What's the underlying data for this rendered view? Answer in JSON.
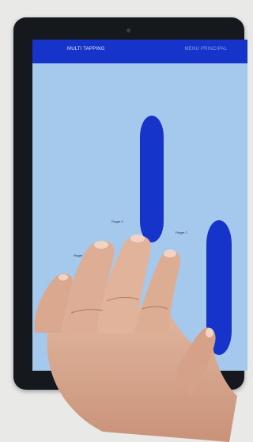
{
  "app": {
    "title": "MULTI TAPPING",
    "action_label": "MENU PRINCIPAL"
  },
  "touches": [
    {
      "label": "Finger 4"
    },
    {
      "label": "Finger 2"
    },
    {
      "label": "Finger 3"
    }
  ],
  "colors": {
    "appbar": "#1634c9",
    "screen_bg": "#a5c9ec",
    "touch": "#1634c9",
    "tablet_frame": "#15181c"
  }
}
